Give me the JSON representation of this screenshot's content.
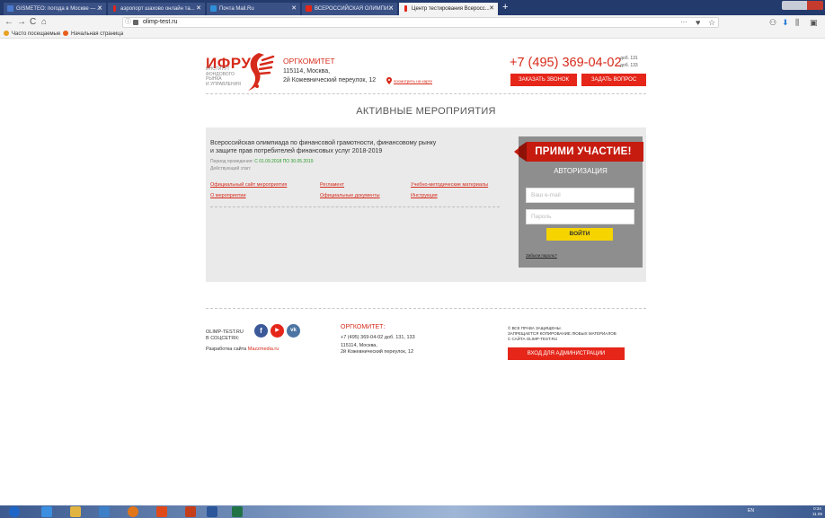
{
  "browser": {
    "tabs": [
      {
        "label": "GISMETEO: погода в Москве — ...",
        "fav_color": "#4a7bd0",
        "active": false
      },
      {
        "label": "аэропорт шахово онлайн та...",
        "fav_color": "#e0281a",
        "active": false
      },
      {
        "label": "Почта Mail.Ru",
        "fav_color": "#2e8fd8",
        "active": false
      },
      {
        "label": "ВСЕРОССИЙСКАЯ ОЛИМПИ...",
        "fav_color": "#e52619",
        "active": false
      },
      {
        "label": "Центр тестирования Всеросс...",
        "fav_color": "#e52619",
        "active": true
      }
    ],
    "new_tab": "+",
    "url": "olimp-test.ru",
    "url_info": "ⓘ",
    "more": "···",
    "bookmarks": [
      {
        "label": "Часто посещаемые",
        "color": "#e8a020"
      },
      {
        "label": "Начальная страница",
        "color": "#e85d1a"
      }
    ]
  },
  "header": {
    "logo_text": "ИФРУ",
    "logo_sub": [
      "ИНСТИТУТ",
      "ФОНДОВОГО",
      "РЫНКА",
      "И УПРАВЛЕНИЯ"
    ],
    "org_title": "ОРГКОМИТЕТ",
    "addr1": "115114, Москва,",
    "addr2": "2й Кожевнический переулок, 12",
    "map_link": "посмотреть на карте",
    "phone": "+7 (495) 369-04-02",
    "ext1": "доб. 131",
    "ext2": "доб. 133",
    "btn_call": "Заказать звонок",
    "btn_ask": "Задать вопрос"
  },
  "main": {
    "section_title": "АКТИВНЫЕ МЕРОПРИЯТИЯ",
    "event": {
      "title_line1": "Всероссийская олимпиада по финансовой грамотности, финансовому рынку",
      "title_line2": "и защите прав потребителей финансовых услуг 2018-2019",
      "period_label": "Период проведения:",
      "period_value": "С 01.09.2018 ПО 30.05.2019",
      "stage_label": "Действующий этап:",
      "links": {
        "official_site": "Официальный сайт мероприятия",
        "reglament": "Регламент",
        "materials": "Учебно-методические материалы",
        "about": "О мероприятии",
        "docs": "Официальные документы",
        "instruction": "Инструкция"
      }
    },
    "auth": {
      "banner": "ПРИМИ УЧАСТИЕ!",
      "title": "АВТОРИЗАЦИЯ",
      "email_placeholder": "Ваш e-mail",
      "password_placeholder": "Пароль",
      "login": "Войти",
      "forgot": "Забыли пароль?"
    }
  },
  "footer": {
    "social_label_1": "OLIMP-TEST.RU",
    "social_label_2": "В СОЦСЕТЯХ:",
    "social": [
      {
        "name": "facebook",
        "glyph": "f",
        "color": "#3b5998"
      },
      {
        "name": "youtube",
        "glyph": "▶",
        "color": "#e52619"
      },
      {
        "name": "vk",
        "glyph": "vk",
        "color": "#4c75a3"
      }
    ],
    "dev_label": "Разработка сайта",
    "dev_link": "Mazzmedia.ru",
    "org_title": "ОРГКОМИТЕТ:",
    "phone": "+7 (495) 369-04-02 доб. 131, 133",
    "addr1": "115114, Москва,",
    "addr2": "2й Кожевнический переулок, 12",
    "rights_1": "© ВСЕ ПРАВА ЗАЩИЩЕНЫ.",
    "rights_2": "ЗАПРЕЩАЕТСЯ КОПИРОВАНИЕ ЛЮБЫХ МАТЕРИАЛОВ",
    "rights_3": "С САЙТА OLIMP-TEST.RU",
    "admin_btn": "Вход для администрации"
  },
  "taskbar": {
    "lang": "EN",
    "time": "0:34",
    "date": "11.09"
  },
  "colors": {
    "accent": "#d62a1a",
    "button": "#e52619",
    "login": "#f5d400"
  }
}
